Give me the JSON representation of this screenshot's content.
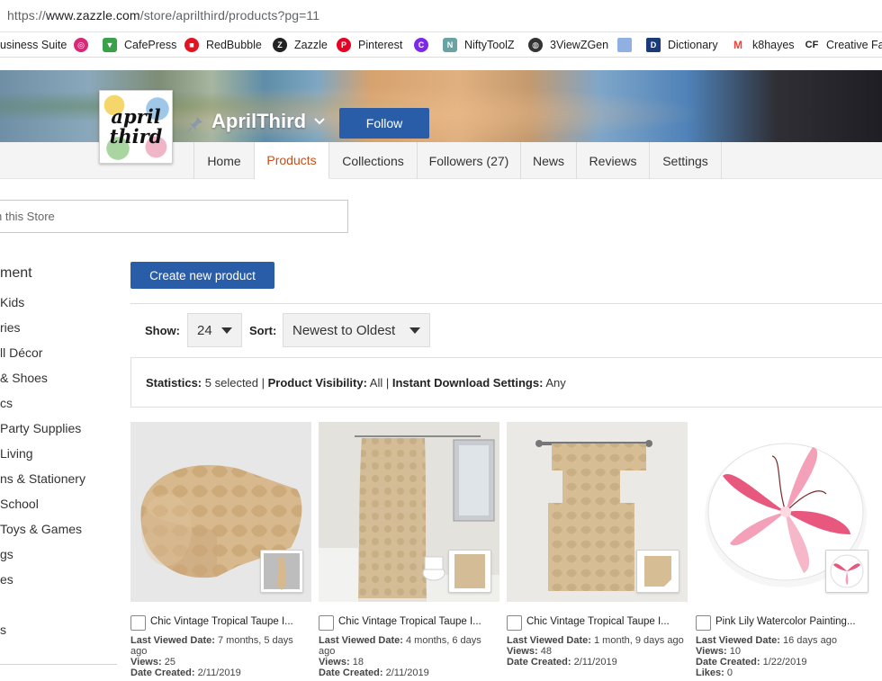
{
  "browser": {
    "url_prefix": "https://",
    "url_domain": "www.zazzle.com",
    "url_path": "/store/aprilthird/products?pg=11"
  },
  "bookmarks": [
    {
      "label": "usiness Suite",
      "icon": "business-suite-icon",
      "color": "#1877f2"
    },
    {
      "label": "",
      "icon": "instagram-icon",
      "color": "#d62976"
    },
    {
      "label": "CafePress",
      "icon": "cafepress-icon",
      "color": "#3aa04a"
    },
    {
      "label": "RedBubble",
      "icon": "redbubble-icon",
      "color": "#e41321"
    },
    {
      "label": "Zazzle",
      "icon": "zazzle-icon",
      "color": "#222222"
    },
    {
      "label": "Pinterest",
      "icon": "pinterest-icon",
      "color": "#e60023"
    },
    {
      "label": "",
      "icon": "canva-icon",
      "color": "#7d2ae8"
    },
    {
      "label": "NiftyToolZ",
      "icon": "niftytoolz-icon",
      "color": "#6aa3a3"
    },
    {
      "label": "3ViewZGen",
      "icon": "3viewzgen-icon",
      "color": "#333333"
    },
    {
      "label": "",
      "icon": "bookmark-icon",
      "color": "#8fb0e0"
    },
    {
      "label": "Dictionary",
      "icon": "dictionary-icon",
      "color": "#1b3a7a"
    },
    {
      "label": "k8hayes",
      "icon": "gmail-icon",
      "color": "#ea4335"
    },
    {
      "label": "Creative Fab",
      "icon": "creative-fabrica-icon",
      "color": "#222222"
    }
  ],
  "store": {
    "logo_line1": "april",
    "logo_line2": "third",
    "name": "AprilThird",
    "follow_label": "Follow"
  },
  "tabs": [
    {
      "label": "Home",
      "active": false
    },
    {
      "label": "Products",
      "active": true
    },
    {
      "label": "Collections",
      "active": false
    },
    {
      "label": "Followers (27)",
      "active": false
    },
    {
      "label": "News",
      "active": false
    },
    {
      "label": "Reviews",
      "active": false
    },
    {
      "label": "Settings",
      "active": false
    }
  ],
  "search": {
    "placeholder": "h this Store"
  },
  "sidebar": {
    "title": "ment",
    "items": [
      "Kids",
      "ries",
      "ll Décor",
      "& Shoes",
      "cs",
      "Party Supplies",
      "Living",
      "ns & Stationery",
      "School",
      "Toys & Games",
      "gs",
      "es",
      "",
      "s"
    ]
  },
  "toolbar": {
    "create_label": "Create new product",
    "show_label": "Show:",
    "show_value": "24",
    "sort_label": "Sort:",
    "sort_value": "Newest to Oldest"
  },
  "stats": {
    "statistics_label": "Statistics:",
    "statistics_value": " 5 selected | ",
    "visibility_label": "Product Visibility:",
    "visibility_value": " All | ",
    "download_label": "Instant Download Settings:",
    "download_value": " Any"
  },
  "labels": {
    "last_viewed": "Last Viewed Date:",
    "views": "Views:",
    "created": "Date Created:",
    "likes": "Likes:"
  },
  "products": [
    {
      "title": "Chic Vintage Tropical Taupe I...",
      "last_viewed": " 7 months, 5 days ago",
      "views": " 25",
      "created": " 2/11/2019",
      "likes": null
    },
    {
      "title": "Chic Vintage Tropical Taupe I...",
      "last_viewed": " 4 months, 6 days ago",
      "views": " 18",
      "created": " 2/11/2019",
      "likes": null
    },
    {
      "title": "Chic Vintage Tropical Taupe I...",
      "last_viewed": " 1 month, 9 days ago",
      "views": " 48",
      "created": " 2/11/2019",
      "likes": null
    },
    {
      "title": "Pink Lily Watercolor Painting...",
      "last_viewed": " 16 days ago",
      "views": " 10",
      "created": " 1/22/2019",
      "likes": " 0"
    }
  ]
}
